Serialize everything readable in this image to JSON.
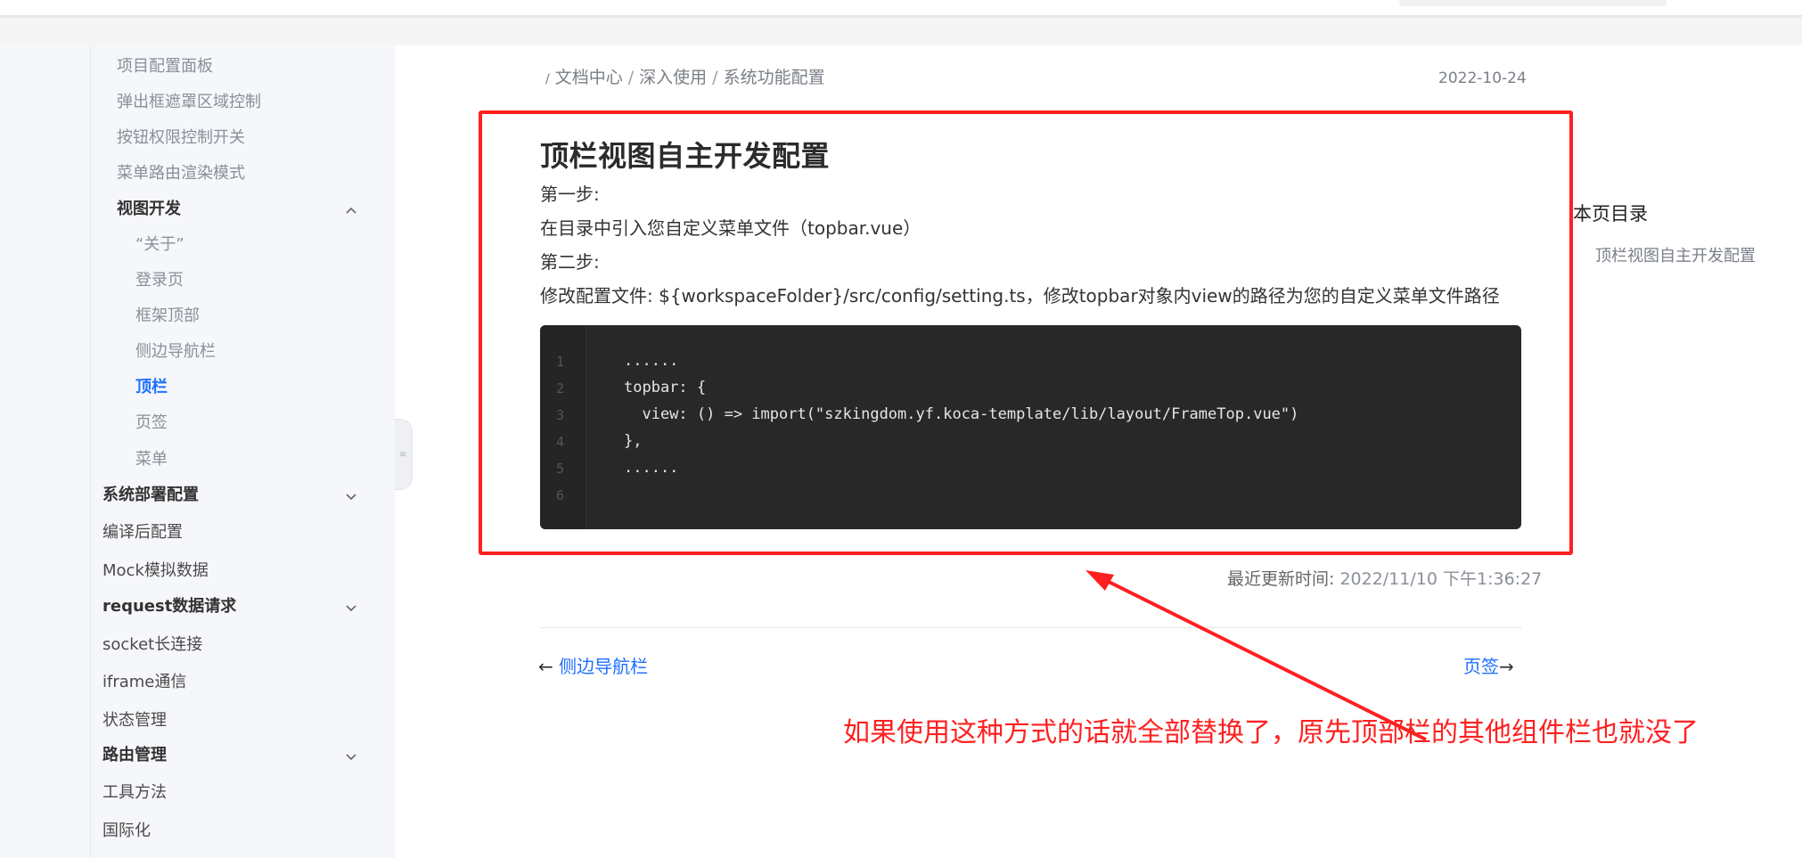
{
  "sidebar": {
    "items": [
      {
        "label": "项目配置面板"
      },
      {
        "label": "弹出框遮罩区域控制"
      },
      {
        "label": "按钮权限控制开关"
      },
      {
        "label": "菜单路由渲染模式"
      },
      {
        "label": "视图开发"
      },
      {
        "label": "“关于”"
      },
      {
        "label": "登录页"
      },
      {
        "label": "框架顶部"
      },
      {
        "label": "侧边导航栏"
      },
      {
        "label": "顶栏"
      },
      {
        "label": "页签"
      },
      {
        "label": "菜单"
      },
      {
        "label": "系统部署配置"
      },
      {
        "label": "编译后配置"
      },
      {
        "label": "Mock模拟数据"
      },
      {
        "label": "request数据请求"
      },
      {
        "label": "socket长连接"
      },
      {
        "label": "iframe通信"
      },
      {
        "label": "状态管理"
      },
      {
        "label": "路由管理"
      },
      {
        "label": "工具方法"
      },
      {
        "label": "国际化"
      }
    ],
    "active_item": "顶栏"
  },
  "breadcrumb": {
    "lead": "/",
    "items": [
      "文档中心",
      "深入使用",
      "系统功能配置"
    ],
    "sep": "/"
  },
  "page_date": "2022-10-24",
  "article": {
    "title": "顶栏视图自主开发配置",
    "step1_label": "第一步:",
    "step1_text": "在目录中引入您自定义菜单文件（topbar.vue）",
    "step2_label": "第二步:",
    "step2_text": "修改配置文件: ${workspaceFolder}/src/config/setting.ts，修改topbar对象内view的路径为您的自定义菜单文件路径"
  },
  "code": {
    "line_numbers": [
      "1",
      "2",
      "3",
      "4",
      "5",
      "6"
    ],
    "lines": [
      "......",
      "topbar: {",
      "  view: () => import(\"szkingdom.yf.koca-template/lib/layout/FrameTop.vue\")",
      "},",
      "......",
      ""
    ]
  },
  "last_updated": {
    "label": "最近更新时间: ",
    "value": "2022/11/10 下午1:36:27"
  },
  "pager": {
    "prev_arrow": "←",
    "prev_label": "侧边导航栏",
    "next_label": "页签",
    "next_arrow": "→"
  },
  "toc": {
    "title": "本页目录",
    "items": [
      "顶栏视图自主开发配置"
    ]
  },
  "annotation": {
    "text": "如果使用这种方式的话就全部替换了，原先顶部栏的其他组件栏也就没了",
    "color": "#ff2020"
  },
  "colors": {
    "accent": "#1e6fff",
    "code_bg": "#282828",
    "sidebar_bg": "#f5f7fa",
    "annotation_red": "#ff2020"
  },
  "icons": {
    "chevron_up": "chevron-up-icon",
    "chevron_down": "chevron-down-icon"
  }
}
